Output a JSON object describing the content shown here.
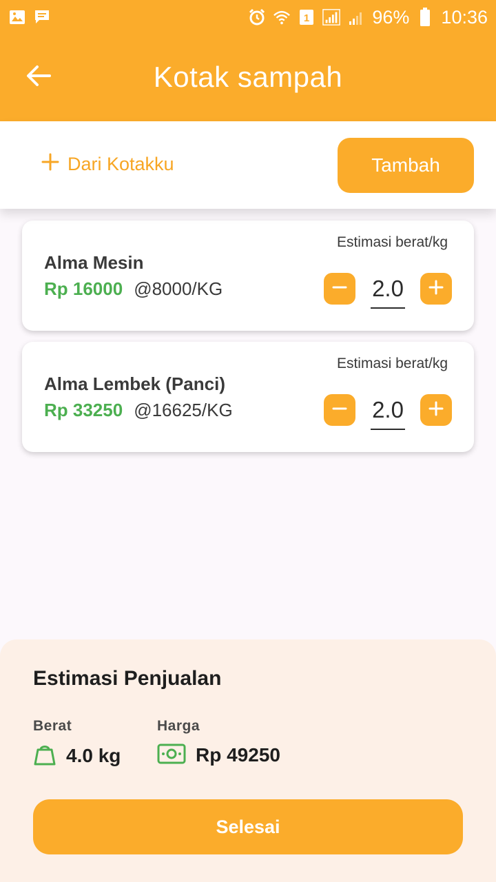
{
  "colors": {
    "primary": "#fbac2b",
    "price_green": "#4caf50",
    "summary_bg": "#fdf0e7",
    "page_bg": "#fcf8fc"
  },
  "status_bar": {
    "left_icons": [
      "image-icon",
      "chat-icon"
    ],
    "right_icons": [
      "alarm-icon",
      "wifi-icon",
      "sim-1-icon",
      "signal-icon",
      "signal-weak-icon",
      "battery-icon"
    ],
    "battery": "96%",
    "time": "10:36"
  },
  "app_bar": {
    "back_icon": "arrow-left-icon",
    "title": "Kotak sampah"
  },
  "actions": {
    "from_box_icon": "plus-icon",
    "from_box_label": "Dari Kotakku",
    "add_label": "Tambah"
  },
  "items": [
    {
      "name": "Alma Mesin",
      "price": "Rp 16000",
      "rate": "@8000/KG",
      "estimate_label": "Estimasi berat/kg",
      "quantity": "2.0"
    },
    {
      "name": "Alma Lembek (Panci)",
      "price": "Rp 33250",
      "rate": "@16625/KG",
      "estimate_label": "Estimasi berat/kg",
      "quantity": "2.0"
    }
  ],
  "summary": {
    "title": "Estimasi Penjualan",
    "weight_label": "Berat",
    "weight_icon": "weight-icon",
    "weight_value": "4.0 kg",
    "price_label": "Harga",
    "price_icon": "cash-icon",
    "price_value": "Rp 49250",
    "done_label": "Selesai"
  }
}
